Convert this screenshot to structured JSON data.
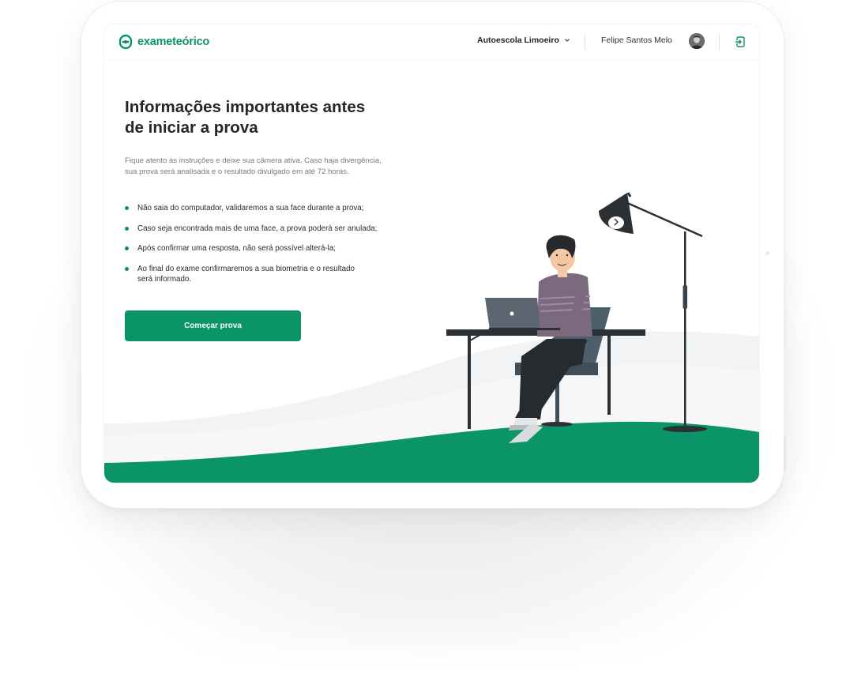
{
  "brand": {
    "logo_text": "exameteórico",
    "logo_icon": "exameteorico-logo-icon",
    "accent_color": "#0a9467"
  },
  "header": {
    "school": "Autoescola Limoeiro",
    "school_icon": "chevron-down-icon",
    "user_name": "Felipe Santos Melo",
    "logout_icon": "logout-icon"
  },
  "main": {
    "title_line1": "Informações importantes antes",
    "title_line2": "de iniciar a prova",
    "subtitle_line1": "Fique atento às instruções e deixe sua câmera ativa. Caso haja divergência,",
    "subtitle_line2": "sua prova será analisada e o resultado divulgado em até 72 horas.",
    "rules": [
      {
        "text": "Não saia do computador, validaremos a sua face durante a prova;"
      },
      {
        "text": "Caso seja encontrada mais de uma face, a prova poderá ser anulada;"
      },
      {
        "text": "Após confirmar uma resposta, não será possível alterá-la;"
      },
      {
        "line1": "Ao final do exame confirmaremos a sua biometria e o resultado",
        "line2": "será informado."
      }
    ],
    "start_button": "Começar prova"
  }
}
